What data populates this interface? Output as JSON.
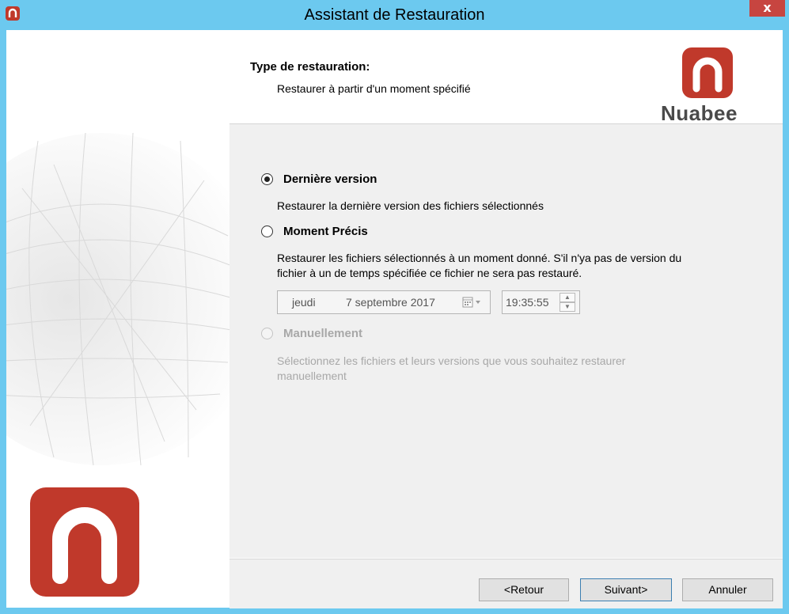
{
  "window": {
    "title": "Assistant de Restauration",
    "close_label": "x"
  },
  "header": {
    "title": "Type de restauration:",
    "subtitle": "Restaurer à partir d'un moment spécifié",
    "brand_name": "Nuabee"
  },
  "options": {
    "last_version": {
      "label": "Dernière version",
      "description": "Restaurer la dernière version des fichiers sélectionnés",
      "selected": true
    },
    "precise_moment": {
      "label": "Moment Précis",
      "description_line1": "Restaurer les fichiers sélectionnés à un moment donné. S'il n'ya pas de version du",
      "description_line2": "fichier à un de temps spécifiée ce fichier ne sera pas restauré.",
      "date_day": "jeudi",
      "date_value": "7 septembre 2017",
      "time_value": "19:35:55"
    },
    "manual": {
      "label": "Manuellement",
      "description_line1": "Sélectionnez les fichiers et leurs versions que vous souhaitez restaurer",
      "description_line2": "manuellement",
      "enabled": false
    }
  },
  "footer": {
    "back_label": "<Retour",
    "next_label": "Suivant>",
    "cancel_label": "Annuler"
  },
  "colors": {
    "titlebar": "#6cc9ef",
    "brand_red": "#c0392b",
    "close_red": "#c74540",
    "content_bg": "#f0f0f0"
  }
}
